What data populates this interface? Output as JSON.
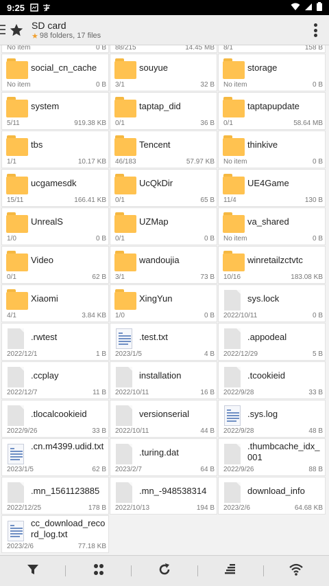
{
  "status": {
    "time": "9:25"
  },
  "header": {
    "title": "SD card",
    "subtitle": "98 folders, 17 files"
  },
  "top_partial": [
    {
      "left": "No item",
      "right": "0 B"
    },
    {
      "left": "88/215",
      "right": "14.45 MB"
    },
    {
      "left": "8/1",
      "right": "158 B"
    }
  ],
  "items": [
    {
      "name": "social_cn_cache",
      "type": "folder",
      "left": "No item",
      "right": "0 B"
    },
    {
      "name": "souyue",
      "type": "folder",
      "left": "3/1",
      "right": "32 B"
    },
    {
      "name": "storage",
      "type": "folder",
      "left": "No item",
      "right": "0 B"
    },
    {
      "name": "system",
      "type": "folder",
      "left": "5/11",
      "right": "919.38 KB"
    },
    {
      "name": "taptap_did",
      "type": "folder",
      "left": "0/1",
      "right": "36 B"
    },
    {
      "name": "taptapupdate",
      "type": "folder",
      "left": "0/1",
      "right": "58.64 MB"
    },
    {
      "name": "tbs",
      "type": "folder",
      "left": "1/1",
      "right": "10.17 KB"
    },
    {
      "name": "Tencent",
      "type": "folder",
      "left": "46/183",
      "right": "57.97 KB"
    },
    {
      "name": "thinkive",
      "type": "folder",
      "left": "No item",
      "right": "0 B"
    },
    {
      "name": "ucgamesdk",
      "type": "folder",
      "left": "15/11",
      "right": "166.41 KB"
    },
    {
      "name": "UcQkDir",
      "type": "folder",
      "left": "0/1",
      "right": "65 B"
    },
    {
      "name": "UE4Game",
      "type": "folder",
      "left": "11/4",
      "right": "130 B"
    },
    {
      "name": "UnrealS",
      "type": "folder",
      "left": "1/0",
      "right": "0 B"
    },
    {
      "name": "UZMap",
      "type": "folder",
      "left": "0/1",
      "right": "0 B"
    },
    {
      "name": "va_shared",
      "type": "folder",
      "left": "No item",
      "right": "0 B"
    },
    {
      "name": "Video",
      "type": "folder",
      "left": "0/1",
      "right": "62 B"
    },
    {
      "name": "wandoujia",
      "type": "folder",
      "left": "3/1",
      "right": "73 B"
    },
    {
      "name": "winretailzctvtc",
      "type": "folder",
      "left": "10/16",
      "right": "183.08 KB"
    },
    {
      "name": "Xiaomi",
      "type": "folder",
      "left": "4/1",
      "right": "3.84 KB"
    },
    {
      "name": "XingYun",
      "type": "folder",
      "left": "1/0",
      "right": "0 B"
    },
    {
      "name": "sys.lock",
      "type": "file",
      "left": "2022/10/11",
      "right": "0 B"
    },
    {
      "name": ".rwtest",
      "type": "file",
      "left": "2022/12/1",
      "right": "1 B"
    },
    {
      "name": ".test.txt",
      "type": "text",
      "left": "2023/1/5",
      "right": "4 B"
    },
    {
      "name": ".appodeal",
      "type": "file",
      "left": "2022/12/29",
      "right": "5 B"
    },
    {
      "name": ".ccplay",
      "type": "file",
      "left": "2022/12/7",
      "right": "11 B"
    },
    {
      "name": "installation",
      "type": "file",
      "left": "2022/10/11",
      "right": "16 B"
    },
    {
      "name": ".tcookieid",
      "type": "file",
      "left": "2022/9/28",
      "right": "33 B"
    },
    {
      "name": ".tlocalcookieid",
      "type": "file",
      "left": "2022/9/26",
      "right": "33 B"
    },
    {
      "name": "versionserial",
      "type": "file",
      "left": "2022/10/11",
      "right": "44 B"
    },
    {
      "name": ".sys.log",
      "type": "text",
      "left": "2022/9/28",
      "right": "48 B"
    },
    {
      "name": ".cn.m4399.udid.txt",
      "type": "text",
      "left": "2023/1/5",
      "right": "62 B"
    },
    {
      "name": ".turing.dat",
      "type": "file",
      "left": "2023/2/7",
      "right": "64 B"
    },
    {
      "name": ".thumbcache_idx_001",
      "type": "file",
      "left": "2022/9/26",
      "right": "88 B"
    },
    {
      "name": ".mn_1561123885",
      "type": "file",
      "left": "2022/12/25",
      "right": "178 B"
    },
    {
      "name": ".mn_-948538314",
      "type": "file",
      "left": "2022/10/13",
      "right": "194 B"
    },
    {
      "name": "download_info",
      "type": "file",
      "left": "2023/2/6",
      "right": "64.68 KB"
    },
    {
      "name": "cc_download_record_log.txt",
      "type": "text",
      "left": "2023/2/6",
      "right": "77.18 KB"
    }
  ],
  "bottom_bar": [
    {
      "name": "filter-icon"
    },
    {
      "name": "apps-icon"
    },
    {
      "name": "refresh-icon"
    },
    {
      "name": "sort-icon"
    },
    {
      "name": "wifi-icon"
    }
  ]
}
